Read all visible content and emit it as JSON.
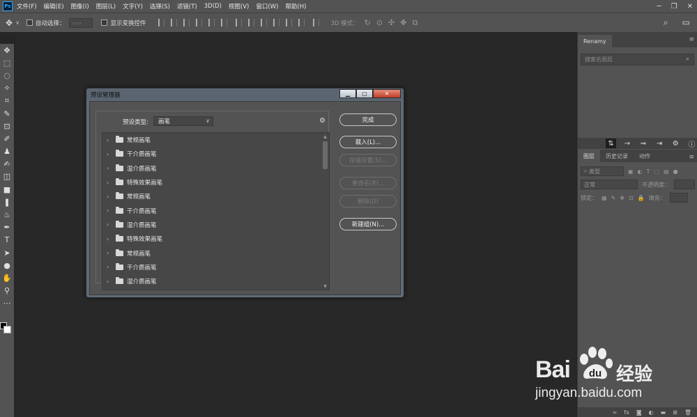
{
  "app": {
    "logo": "Ps"
  },
  "menubar": {
    "items": [
      "文件(F)",
      "编辑(E)",
      "图像(I)",
      "图层(L)",
      "文字(Y)",
      "选择(S)",
      "滤镜(T)",
      "3D(D)",
      "视图(V)",
      "窗口(W)",
      "帮助(H)"
    ],
    "window_controls": [
      "─",
      "❐",
      "✕"
    ]
  },
  "options_bar": {
    "auto_select_label": "自动选择：",
    "show_transform_label": "显示变换控件",
    "mode_3d_label": "3D 模式："
  },
  "tools": [
    "✥",
    "⬚",
    "◌",
    "✧",
    "⌗",
    "✎",
    "⊡",
    "✐",
    "♟",
    "✍",
    "◫",
    "■",
    "❚",
    "♨",
    "✒",
    "T",
    "➤",
    "●",
    "✋",
    "⚲",
    "⋯"
  ],
  "right_panel": {
    "renamy_tab": "Renamy",
    "search_placeholder": "搜索名图层",
    "layers_tab": "图层",
    "history_tab": "历史记录",
    "actions_tab": "动作",
    "filter_kind": "类型",
    "blend_mode": "正常",
    "opacity_label": "不透明度：",
    "lock_label": "锁定：",
    "fill_label": "填充："
  },
  "dialog": {
    "title": "预设管理器",
    "preset_type_label": "预设类型:",
    "preset_type_value": "画笔",
    "items": [
      "常规画笔",
      "干介质画笔",
      "湿介质画笔",
      "特殊效果画笔",
      "常规画笔",
      "干介质画笔",
      "湿介质画笔",
      "特殊效果画笔",
      "常规画笔",
      "干介质画笔",
      "湿介质画笔"
    ],
    "buttons": {
      "done": "完成",
      "load": "载入(L)...",
      "save_set": "存储设置(S)...",
      "rename": "重命名(R)...",
      "delete": "删除(D)",
      "new_group": "新建组(N)..."
    }
  },
  "watermark": {
    "brand_a": "Bai",
    "brand_b": "经验",
    "url": "jingyan.baidu.com"
  }
}
